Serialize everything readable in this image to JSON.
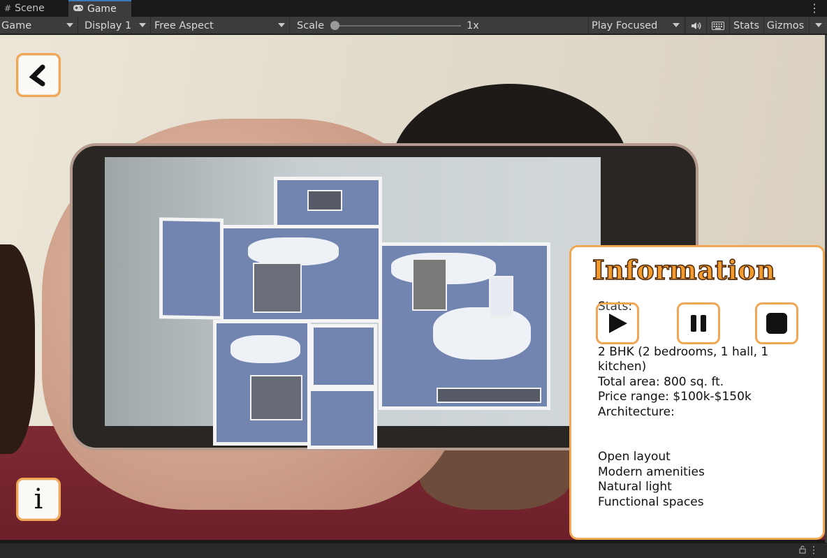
{
  "tabs": [
    {
      "icon": "scene-grid-icon",
      "label": "Scene"
    },
    {
      "icon": "gamepad-icon",
      "label": "Game"
    }
  ],
  "toolbar": {
    "mode": "Game",
    "display": "Display 1",
    "aspect": "Free Aspect",
    "scale_label": "Scale",
    "scale_value": "1x",
    "scale_fraction": 0.0,
    "play_mode": "Play Focused",
    "stats": "Stats",
    "gizmos": "Gizmos"
  },
  "overlay": {
    "back_icon": "chevron-left-icon",
    "info_label": "i"
  },
  "info_panel": {
    "title": "Information",
    "body": "Stats:\n\n\n2 BHK (2 bedrooms, 1 hall, 1 kitchen)\nTotal area: 800 sq. ft.\nPrice range: $100k-$150k\nArchitecture:\n\n\nOpen layout\nModern amenities\nNatural light\nFunctional spaces"
  },
  "controls": [
    "play-icon",
    "pause-icon",
    "stop-icon"
  ],
  "colors": {
    "accent_orange": "#f0a652",
    "title_orange": "#f39a2e",
    "editor_bg": "#3c3c3c",
    "active_tab_line": "#3a79bb"
  }
}
